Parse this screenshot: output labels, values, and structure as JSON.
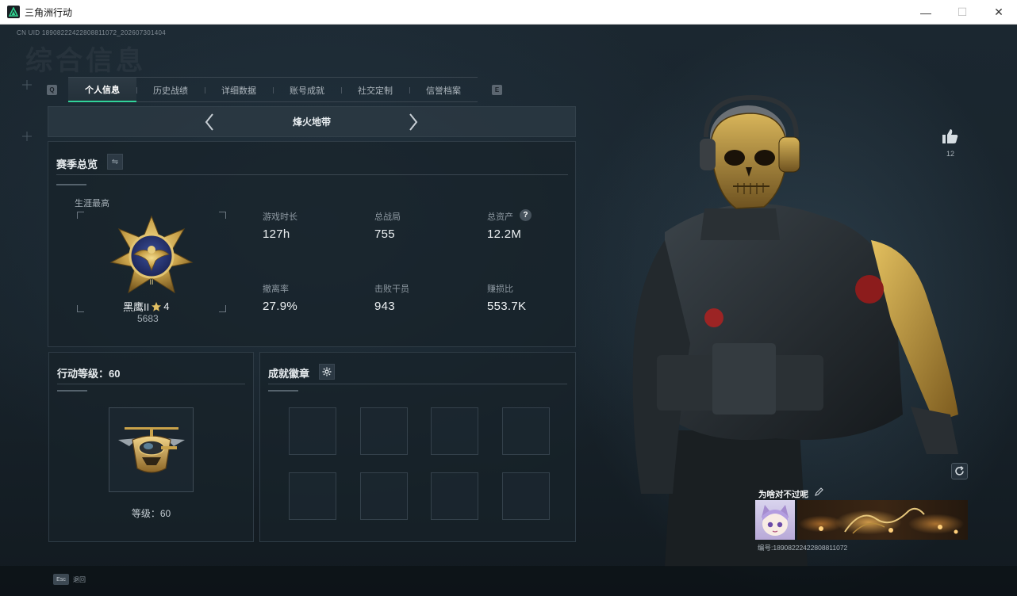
{
  "window": {
    "title": "三角洲行动",
    "minimize": "—",
    "maximize": "☐",
    "close": "✕"
  },
  "uid_text": "CN UID 18908222422808811072_202607301404",
  "page_title_watermark": "综合信息",
  "tabs": {
    "left_key": "Q",
    "right_key": "E",
    "items": [
      {
        "label": "个人信息",
        "active": true
      },
      {
        "label": "历史战绩",
        "active": false
      },
      {
        "label": "详细数据",
        "active": false
      },
      {
        "label": "账号成就",
        "active": false
      },
      {
        "label": "社交定制",
        "active": false
      },
      {
        "label": "信誉档案",
        "active": false
      }
    ]
  },
  "mode_selector": {
    "mode_name": "烽火地带",
    "prev_icon": "chevron-left-icon",
    "next_icon": "chevron-right-icon"
  },
  "season_overview": {
    "title": "赛季总览",
    "switch_icon": "⇋",
    "career_best_label": "生涯最高",
    "rank_name": "黑鹰II",
    "rank_stars": "4",
    "rank_points": "5683",
    "stats": [
      {
        "label": "游戏时长",
        "value": "127h"
      },
      {
        "label": "总战局",
        "value": "755"
      },
      {
        "label": "总资产",
        "value": "12.2M",
        "help": "?"
      },
      {
        "label": "撤离率",
        "value": "27.9%"
      },
      {
        "label": "击败干员",
        "value": "943"
      },
      {
        "label": "赚损比",
        "value": "553.7K"
      }
    ]
  },
  "action_level": {
    "title": "行动等级：60",
    "level_text": "等级：60"
  },
  "achievements": {
    "title": "成就徽章",
    "settings_icon": "gear-icon",
    "slot_count": 8
  },
  "profile": {
    "like_count": "12",
    "player_name": "为啥对不过呢",
    "player_id": "编号:18908222422808811072"
  },
  "footer": {
    "esc_key": "Esc",
    "esc_label": "退回"
  },
  "colors": {
    "accent_green": "#31d39a",
    "gold": "#c9a24a"
  }
}
